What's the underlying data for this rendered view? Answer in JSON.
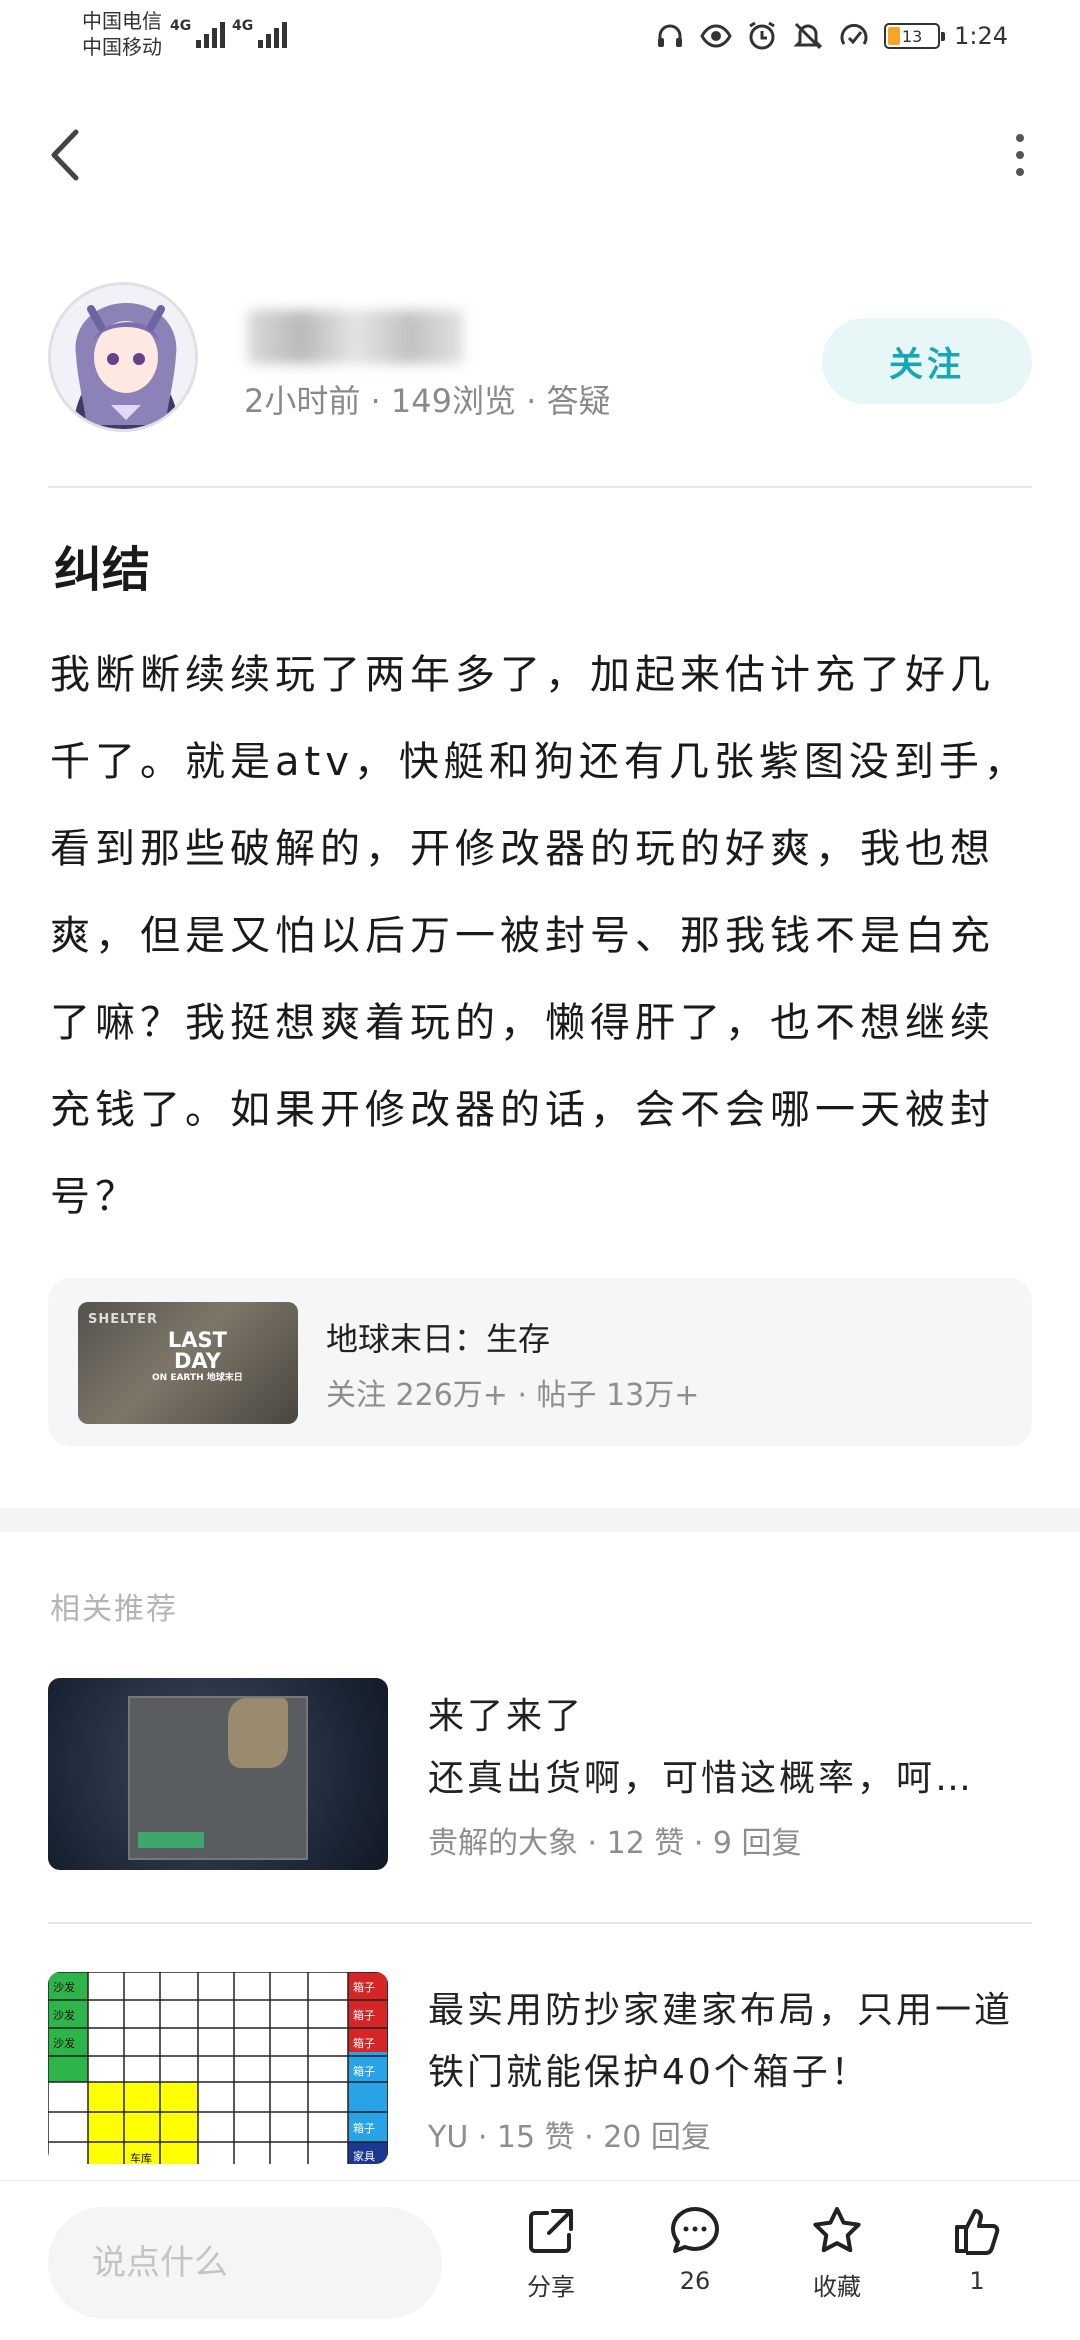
{
  "status_bar": {
    "carrier_1": "中国电信",
    "carrier_2": "中国移动",
    "network_1": "4G",
    "network_2": "4G",
    "battery": "13",
    "time": "1:24",
    "icons": [
      "headphone-icon",
      "eye-icon",
      "alarm-icon",
      "mute-icon",
      "data-saver-icon",
      "battery-icon"
    ]
  },
  "nav": {
    "back_icon": "back-arrow-icon",
    "more_icon": "more-vertical-icon"
  },
  "author": {
    "meta": "2小时前 · 149浏览 · 答疑",
    "follow_label": "关注"
  },
  "post": {
    "title": "纠结",
    "body": "我断断续续玩了两年多了，加起来估计充了好几千了。就是atv，快艇和狗还有几张紫图没到手，看到那些破解的，开修改器的玩的好爽，我也想爽，但是又怕以后万一被封号、那我钱不是白充了嘛？我挺想爽着玩的，懒得肝了，也不想继续充钱了。如果开修改器的话，会不会哪一天被封号？"
  },
  "game_card": {
    "name": "地球末日：生存",
    "stats": "关注 226万+ · 帖子 13万+",
    "thumb_shelter": "SHELTER",
    "thumb_logo_1": "LAST",
    "thumb_logo_2": "DAY",
    "thumb_logo_3": "ON EARTH 地球末日"
  },
  "related": {
    "heading": "相关推荐",
    "items": [
      {
        "title": "来了来了\n还真出货啊，可惜这概率，呵…",
        "meta": "贵解的大象 · 12 赞 · 9 回复"
      },
      {
        "title": "最实用防抄家建家布局，只用一道铁门就能保护40个箱子！",
        "meta": "YU · 15 赞 · 20 回复"
      }
    ],
    "grid_labels": {
      "left": [
        "沙发",
        "沙发",
        "沙发"
      ],
      "right": [
        "箱子",
        "箱子",
        "箱子",
        "箱子",
        "箱子",
        "家具"
      ],
      "yellow": "车库"
    }
  },
  "bottom_bar": {
    "comment_placeholder": "说点什么",
    "share_label": "分享",
    "comments_count": "26",
    "favorite_label": "收藏",
    "likes_count": "1"
  },
  "colors": {
    "accent": "#15a8b4",
    "follow_bg": "#e7f6f7",
    "muted_text": "#8a8a8a",
    "card_bg": "#f5f6f8"
  }
}
